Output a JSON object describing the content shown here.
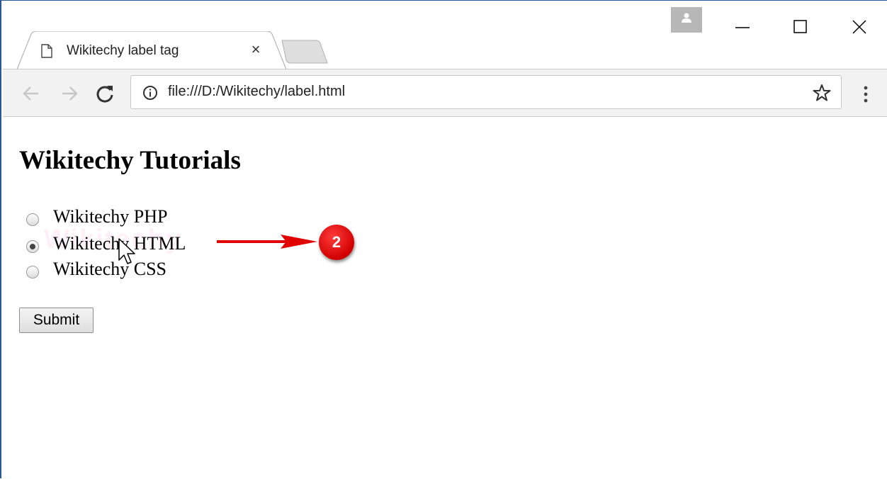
{
  "browser": {
    "tab": {
      "title": "Wikitechy label tag",
      "icon": "page-icon",
      "close_glyph": "×"
    },
    "window_controls": [
      "minimize-icon",
      "maximize-icon",
      "close-icon"
    ],
    "toolbar": {
      "url": "file:///D:/Wikitechy/label.html",
      "icons": [
        "back-arrow-icon",
        "forward-arrow-icon",
        "reload-icon",
        "info-icon",
        "star-icon",
        "menu-dots-icon"
      ]
    }
  },
  "page": {
    "heading": "Wikitechy Tutorials",
    "radio_options": [
      {
        "label": "Wikitechy PHP",
        "checked": false
      },
      {
        "label": "Wikitechy HTML",
        "checked": true
      },
      {
        "label": "Wikitechy CSS",
        "checked": false
      }
    ],
    "submit_label": "Submit",
    "watermark_text": "Wikitechy"
  },
  "annotation": {
    "step_number": "2",
    "color": "#e00000"
  },
  "colors": {
    "window_border": "#2b5797",
    "toolbar_bg": "#f2f2f2"
  }
}
